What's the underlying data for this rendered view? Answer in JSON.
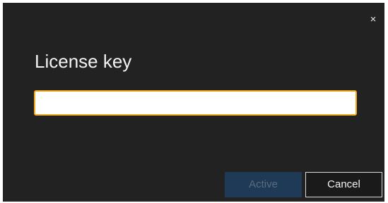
{
  "dialog": {
    "title": "License key",
    "close_glyph": "×",
    "close_icon": "close-icon",
    "input": {
      "value": "",
      "placeholder": ""
    },
    "buttons": {
      "active_label": "Active",
      "cancel_label": "Cancel"
    }
  },
  "colors": {
    "dialog_background": "#222222",
    "input_focus_border": "#f0a81f",
    "active_button_background": "#1e3a57",
    "active_button_text": "#5a6b7f"
  }
}
